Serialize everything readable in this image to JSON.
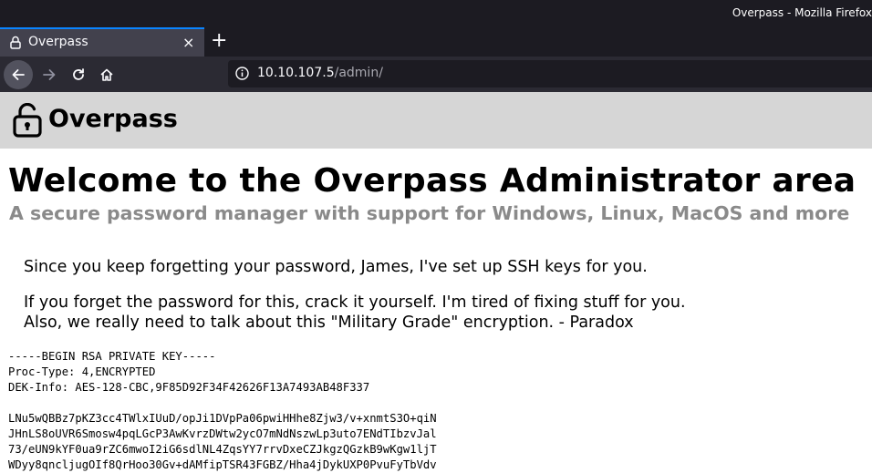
{
  "window": {
    "title": "Overpass - Mozilla Firefox"
  },
  "tab": {
    "label": "Overpass",
    "close": "×"
  },
  "toolbar": {
    "new_tab": "+"
  },
  "urlbar": {
    "host": "10.10.107.5",
    "path": "/admin/"
  },
  "site": {
    "brand": "Overpass"
  },
  "page": {
    "heading": "Welcome to the Overpass Administrator area",
    "subheading": "A secure password manager with support for Windows, Linux, MacOS and more",
    "paragraph1": "Since you keep forgetting your password, James, I've set up SSH keys for you.",
    "paragraph2_line1": "If you forget the password for this, crack it yourself. I'm tired of fixing stuff for you.",
    "paragraph2_line2": "Also, we really need to talk about this \"Military Grade\" encryption. - Paradox",
    "key_lines": [
      "-----BEGIN RSA PRIVATE KEY-----",
      "Proc-Type: 4,ENCRYPTED",
      "DEK-Info: AES-128-CBC,9F85D92F34F42626F13A7493AB48F337",
      "",
      "LNu5wQBBz7pKZ3cc4TWlxIUuD/opJi1DVpPa06pwiHHhe8Zjw3/v+xnmtS3O+qiN",
      "JHnLS8oUVR6Smosw4pqLGcP3AwKvrzDWtw2ycO7mNdNszwLp3uto7ENdTIbzvJal",
      "73/eUN9kYF0ua9rZC6mwoI2iG6sdlNL4ZqsYY7rrvDxeCZJkgzQGzkB9wKgw1ljT",
      "WDyy8qncljugOIf8QrHoo30Gv+dAMfipTSR43FGBZ/Hha4jDykUXP0PvuFyTbVdv"
    ]
  }
}
